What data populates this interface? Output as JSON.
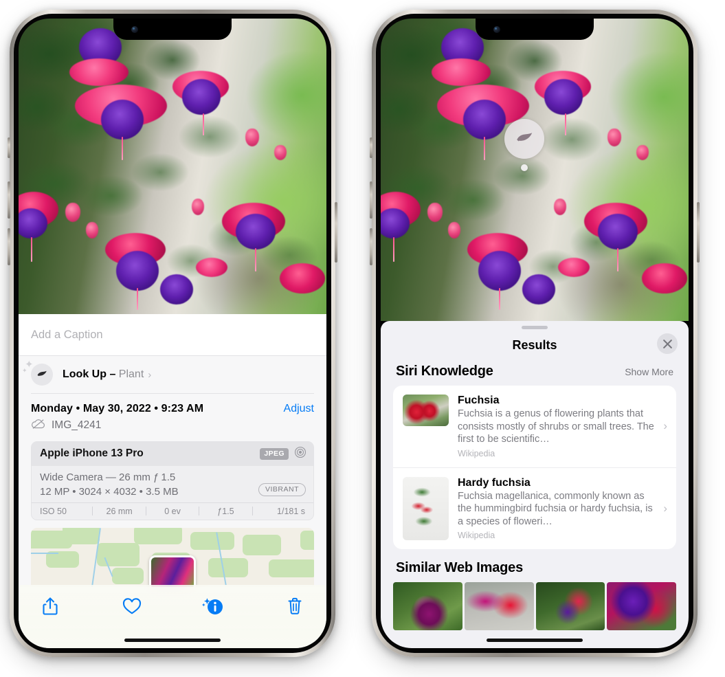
{
  "left_phone": {
    "caption": {
      "placeholder": "Add a Caption",
      "value": ""
    },
    "look_up": {
      "label": "Look Up",
      "dash": " – ",
      "subject": "Plant",
      "chevron": "›",
      "icon": "leaf-icon"
    },
    "date_line": "Monday • May 30, 2022 • 9:23 AM",
    "adjust_label": "Adjust",
    "file_name": "IMG_4241",
    "cloud_icon": "icloud-slash-icon",
    "exif": {
      "device": "Apple iPhone 13 Pro",
      "format_badge": "JPEG",
      "lens_icon": "aperture-icon",
      "lens_line": "Wide Camera — 26 mm ƒ 1.5",
      "size_line": "12 MP • 3024 × 4032 • 3.5 MB",
      "vibrant_badge": "VIBRANT",
      "stats": [
        "ISO 50",
        "26 mm",
        "0 ev",
        "ƒ1.5",
        "1/181 s"
      ]
    },
    "toolbar": [
      {
        "name": "share-button",
        "icon": "share-icon"
      },
      {
        "name": "favorite-button",
        "icon": "heart-icon"
      },
      {
        "name": "info-button",
        "icon": "info-sparkle-icon"
      },
      {
        "name": "delete-button",
        "icon": "trash-icon"
      }
    ]
  },
  "right_phone": {
    "visual_lookup_badge": {
      "icon": "leaf-icon"
    },
    "sheet": {
      "title": "Results",
      "close_label": "✕",
      "siri_knowledge": {
        "title": "Siri Knowledge",
        "show_more": "Show More",
        "cards": [
          {
            "title": "Fuchsia",
            "description": "Fuchsia is a genus of flowering plants that consists mostly of shrubs or small trees. The first to be scientific…",
            "source": "Wikipedia",
            "chevron": "›"
          },
          {
            "title": "Hardy fuchsia",
            "description": "Fuchsia magellanica, commonly known as the hummingbird fuchsia or hardy fuchsia, is a species of floweri…",
            "source": "Wikipedia",
            "chevron": "›"
          }
        ]
      },
      "similar_web_images": {
        "title": "Similar Web Images",
        "count": 4
      }
    }
  },
  "colors": {
    "accent_blue": "#067cf5",
    "sheet_bg": "#f1f1f5",
    "card_bg": "#ffffff",
    "secondary_text": "#8e8e93"
  }
}
